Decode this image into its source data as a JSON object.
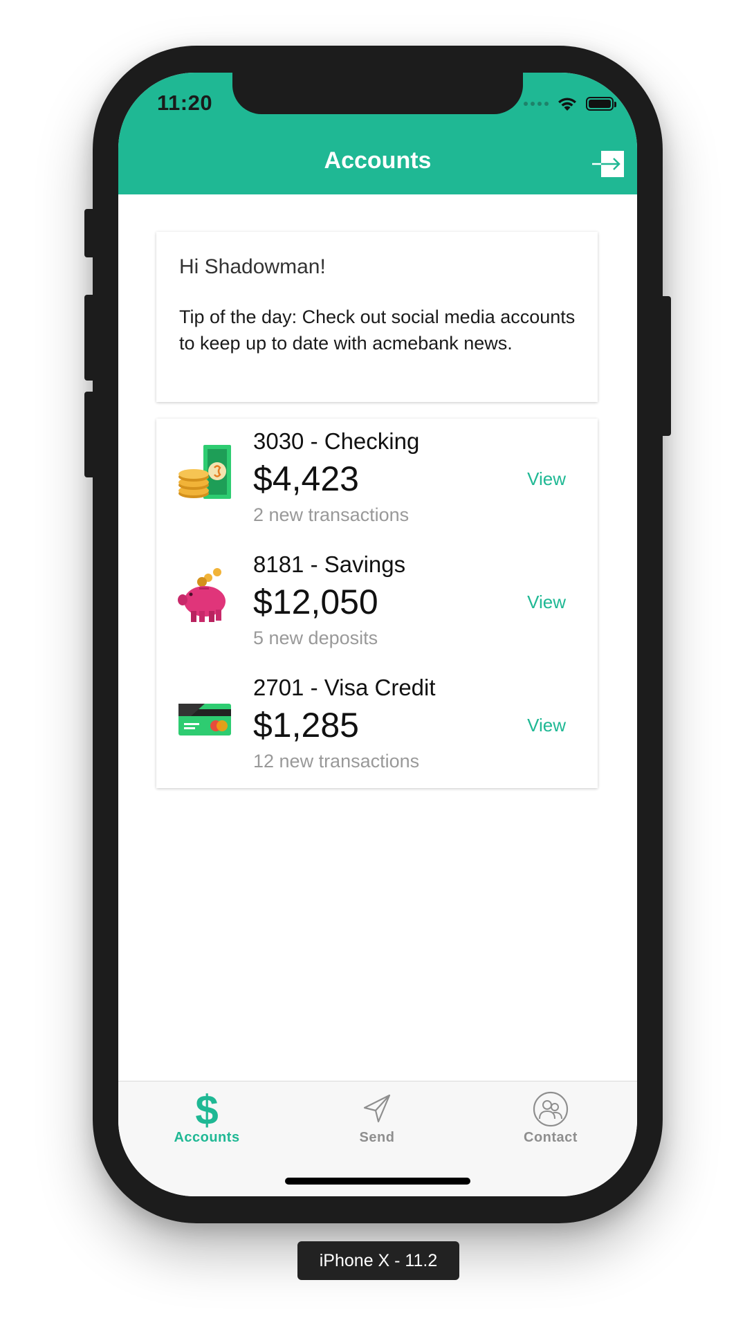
{
  "status_bar": {
    "time": "11:20"
  },
  "header": {
    "title": "Accounts",
    "logout_icon": "logout-arrow-icon"
  },
  "greeting_card": {
    "greeting": "Hi Shadowman!",
    "tip": "Tip of the day: Check out social media accounts to keep up to date with acmebank news."
  },
  "accounts": [
    {
      "name": "3030 - Checking",
      "amount": "$4,423",
      "subtitle": "2 new transactions",
      "action": "View",
      "icon": "coins-cash-icon"
    },
    {
      "name": "8181 - Savings",
      "amount": "$12,050",
      "subtitle": "5 new deposits",
      "action": "View",
      "icon": "piggy-bank-icon"
    },
    {
      "name": "2701 - Visa Credit",
      "amount": "$1,285",
      "subtitle": "12 new transactions",
      "action": "View",
      "icon": "credit-card-icon"
    }
  ],
  "tabs": [
    {
      "label": "Accounts",
      "icon": "dollar-icon",
      "active": true
    },
    {
      "label": "Send",
      "icon": "paper-plane-icon",
      "active": false
    },
    {
      "label": "Contact",
      "icon": "contact-icon",
      "active": false
    }
  ],
  "device_label": "iPhone X - 11.2",
  "colors": {
    "accent": "#1fb894",
    "header": "#1fb894",
    "muted_text": "#999999"
  }
}
